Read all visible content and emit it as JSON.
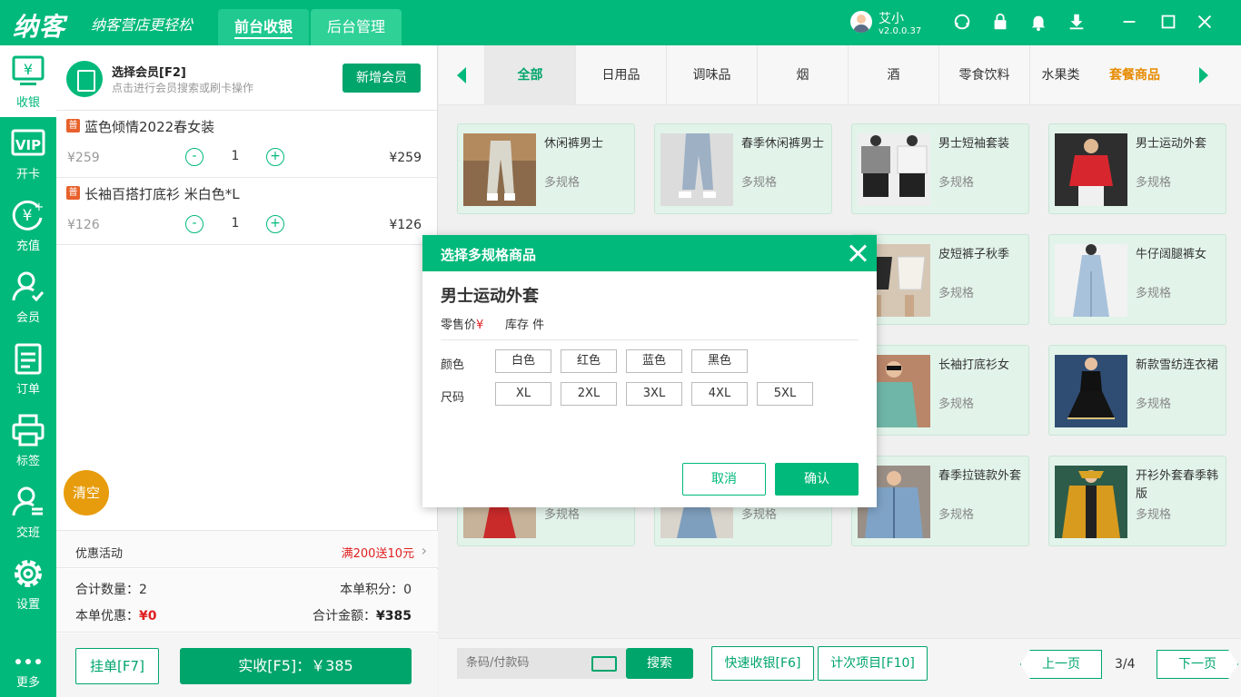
{
  "app": {
    "logo": "纳客",
    "slogan": "纳客营店更轻松",
    "tabs": [
      "前台收银",
      "后台管理"
    ]
  },
  "user": {
    "name": "艾小",
    "version": "v2.0.0.37"
  },
  "sidebar": {
    "items": [
      {
        "label": "收银",
        "icon": "cashier-icon"
      },
      {
        "label": "开卡",
        "icon": "vip-card-icon"
      },
      {
        "label": "充值",
        "icon": "recharge-icon"
      },
      {
        "label": "会员",
        "icon": "member-icon"
      },
      {
        "label": "订单",
        "icon": "order-icon"
      },
      {
        "label": "标签",
        "icon": "printer-icon"
      },
      {
        "label": "交班",
        "icon": "shift-icon"
      },
      {
        "label": "设置",
        "icon": "gear-icon"
      },
      {
        "label": "更多",
        "icon": "more-icon"
      }
    ]
  },
  "member": {
    "title": "选择会员[F2]",
    "subtitle": "点击进行会员搜索或刷卡操作",
    "add_button": "新增会员"
  },
  "cart": {
    "items": [
      {
        "tag": "普",
        "name": "蓝色倾情2022春女装",
        "price": "¥259",
        "qty": "1",
        "subtotal": "¥259"
      },
      {
        "tag": "普",
        "name": "长袖百搭打底衫 米白色*L",
        "price": "¥126",
        "qty": "1",
        "subtotal": "¥126"
      }
    ],
    "minus": "-",
    "plus": "+",
    "clear": "清空",
    "promo_label": "优惠活动",
    "promo_value": "满200送10元",
    "total_qty_label": "合计数量：",
    "total_qty": "2",
    "points_label": "本单积分：",
    "points": "0",
    "discount_label": "本单优惠：",
    "discount": "¥0",
    "total_label": "合计金额：",
    "total": "¥385",
    "hold_button": "挂单[F7]",
    "pay_button": "实收[F5]：￥385"
  },
  "categories": {
    "items": [
      "全部",
      "日用品",
      "调味品",
      "烟",
      "酒",
      "零食饮料",
      "水果类"
    ],
    "combo": "套餐商品"
  },
  "products": [
    {
      "name": "休闲裤男士",
      "spec": "多规格"
    },
    {
      "name": "春季休闲裤男士",
      "spec": "多规格"
    },
    {
      "name": "男士短袖套装",
      "spec": "多规格"
    },
    {
      "name": "男士运动外套",
      "spec": "多规格"
    },
    {
      "name": "皮短裤子秋季",
      "spec": "多规格"
    },
    {
      "name": "牛仔阔腿裤女",
      "spec": "多规格"
    },
    {
      "name": "长袖打底衫女",
      "spec": "多规格"
    },
    {
      "name": "新款雪纺连衣裙",
      "spec": "多规格"
    },
    {
      "name": "",
      "spec": "多规格"
    },
    {
      "name": "",
      "spec": "多规格"
    },
    {
      "name": "春季拉链款外套",
      "spec": "多规格"
    },
    {
      "name": "开衫外套春季韩版",
      "spec": "多规格"
    }
  ],
  "bottom": {
    "barcode_placeholder": "条码/付款码",
    "search": "搜索",
    "quick_pay": "快速收银[F6]",
    "count_items": "计次项目[F10]",
    "prev": "上一页",
    "page": "3/4",
    "next": "下一页"
  },
  "modal": {
    "title": "选择多规格商品",
    "product": "男士运动外套",
    "price_label": "零售价",
    "currency": "¥",
    "stock_label": "库存 件",
    "color_label": "颜色",
    "colors": [
      "白色",
      "红色",
      "蓝色",
      "黑色"
    ],
    "size_label": "尺码",
    "sizes": [
      "XL",
      "2XL",
      "3XL",
      "4XL",
      "5XL"
    ],
    "cancel": "取消",
    "confirm": "确认"
  },
  "colors": {
    "primary": "#00b97a",
    "primary_dark": "#00a56c",
    "danger": "#e02020",
    "orange": "#e79c0d"
  }
}
